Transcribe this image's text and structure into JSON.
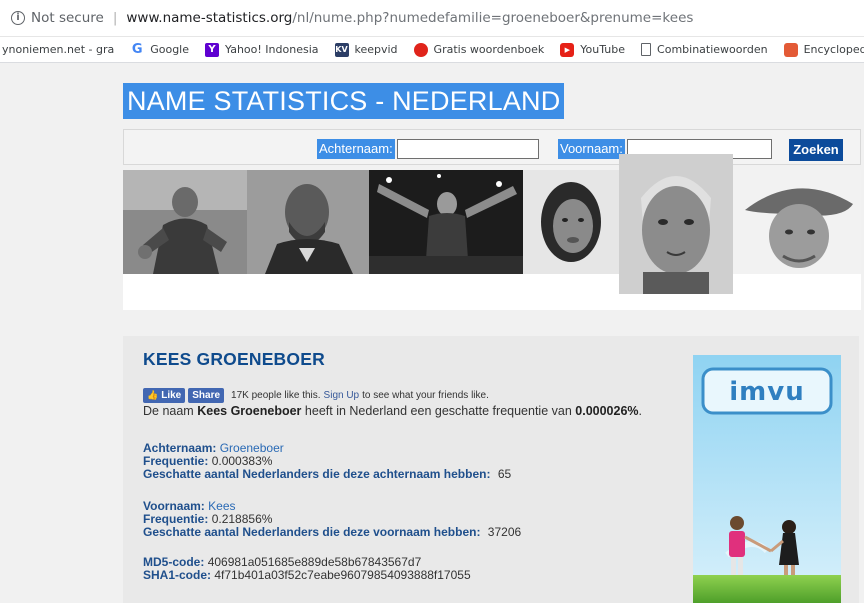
{
  "browser": {
    "security_label": "Not secure",
    "url_host": "www.name-statistics.org",
    "url_path": "/nl/nume.php?numedefamilie=groeneboer&prenume=kees"
  },
  "bookmarks": [
    {
      "label": "ynoniemen.net - gra",
      "icon": "page-icon"
    },
    {
      "label": "Google",
      "icon": "google-icon"
    },
    {
      "label": "Yahoo! Indonesia",
      "icon": "yahoo-icon"
    },
    {
      "label": "keepvid",
      "icon": "keepvid-icon"
    },
    {
      "label": "Gratis woordenboek",
      "icon": "woordenboek-icon"
    },
    {
      "label": "YouTube",
      "icon": "youtube-icon"
    },
    {
      "label": "Combinatiewoorden",
      "icon": "page-icon"
    },
    {
      "label": "Encyclopedie - Ne",
      "icon": "encyclopedie-icon"
    }
  ],
  "site": {
    "title": "NAME STATISTICS - NEDERLAND"
  },
  "search": {
    "surname_label": "Achternaam:",
    "surname_value": "",
    "firstname_label": "Voornaam:",
    "firstname_value": "",
    "button_label": "Zoeken"
  },
  "result": {
    "heading": "KEES GROENEBOER",
    "facebook": {
      "like_label": "Like",
      "share_label": "Share",
      "count_text": "17K people like this.",
      "signup_link": "Sign Up",
      "signup_suffix": "to see what your friends like."
    },
    "sentence_prefix": "De naam",
    "sentence_name": "Kees Groeneboer",
    "sentence_middle": "heeft in Nederland een geschatte frequentie van",
    "sentence_value": "0.000026%",
    "sentence_end": ".",
    "surname": {
      "label": "Achternaam:",
      "value": "Groeneboer",
      "freq_label": "Frequentie:",
      "freq_value": "0.000383%",
      "count_label": "Geschatte aantal Nederlanders die deze achternaam hebben:",
      "count_value": "65"
    },
    "firstname": {
      "label": "Voornaam:",
      "value": "Kees",
      "freq_label": "Frequentie:",
      "freq_value": "0.218856%",
      "count_label": "Geschatte aantal Nederlanders die deze voornaam hebben:",
      "count_value": "37206"
    },
    "hashes": {
      "md5_label": "MD5-code:",
      "md5_value": "406981a051685e889de58b67843567d7",
      "sha1_label": "SHA1-code:",
      "sha1_value": "4f71b401a03f52c7eabe96079854093888f17055"
    }
  },
  "ad": {
    "logo_text": "imvu"
  },
  "colors": {
    "accent": "#3d8ee6",
    "button": "#0c4b9b",
    "heading": "#0f4b8d",
    "label": "#1f4f8c"
  }
}
